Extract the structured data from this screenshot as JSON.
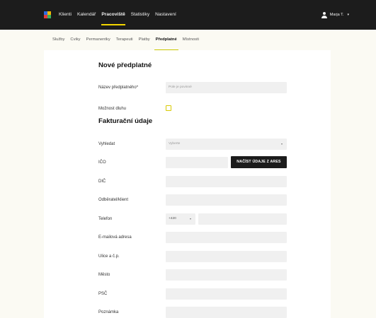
{
  "topnav": {
    "items": [
      {
        "label": "Klienti",
        "active": false
      },
      {
        "label": "Kalendář",
        "active": false
      },
      {
        "label": "Pracoviště",
        "active": true
      },
      {
        "label": "Statistiky",
        "active": false
      },
      {
        "label": "Nastavení",
        "active": false
      }
    ],
    "user_name": "Marja T.",
    "user_caret": "▾"
  },
  "subnav": {
    "tabs": [
      {
        "label": "Služby"
      },
      {
        "label": "Cviky"
      },
      {
        "label": "Permanentky"
      },
      {
        "label": "Terapeuti"
      },
      {
        "label": "Platby"
      },
      {
        "label": "Předplatné",
        "active": true
      },
      {
        "label": "Místnosti"
      }
    ]
  },
  "form": {
    "title": "Nové předplatné",
    "name_label": "Název předplatného*",
    "name_placeholder": "Pole je povinné",
    "debt_label": "Možnost dluhu",
    "billing_title": "Fakturační údaje",
    "search_label": "Vyhledat",
    "search_placeholder": "Vyberte",
    "search_caret": "▾",
    "ico_label": "IČO",
    "ares_button": "NAČÍST ÚDAJE Z ARES",
    "dic_label": "DIČ",
    "client_label": "Odběratel/klient",
    "phone_label": "Telefon",
    "phone_prefix": "+420",
    "phone_prefix_caret": "▾",
    "email_label": "E-mailová adresa",
    "street_label": "Ulice a č.p.",
    "city_label": "Město",
    "zip_label": "PSČ",
    "note_label": "Poznámka"
  },
  "colors": {
    "topbar": "#1c1c1c",
    "accent": "#f3d500",
    "page_bg": "#fbfaf3",
    "field_bg": "#f0f0f0"
  }
}
